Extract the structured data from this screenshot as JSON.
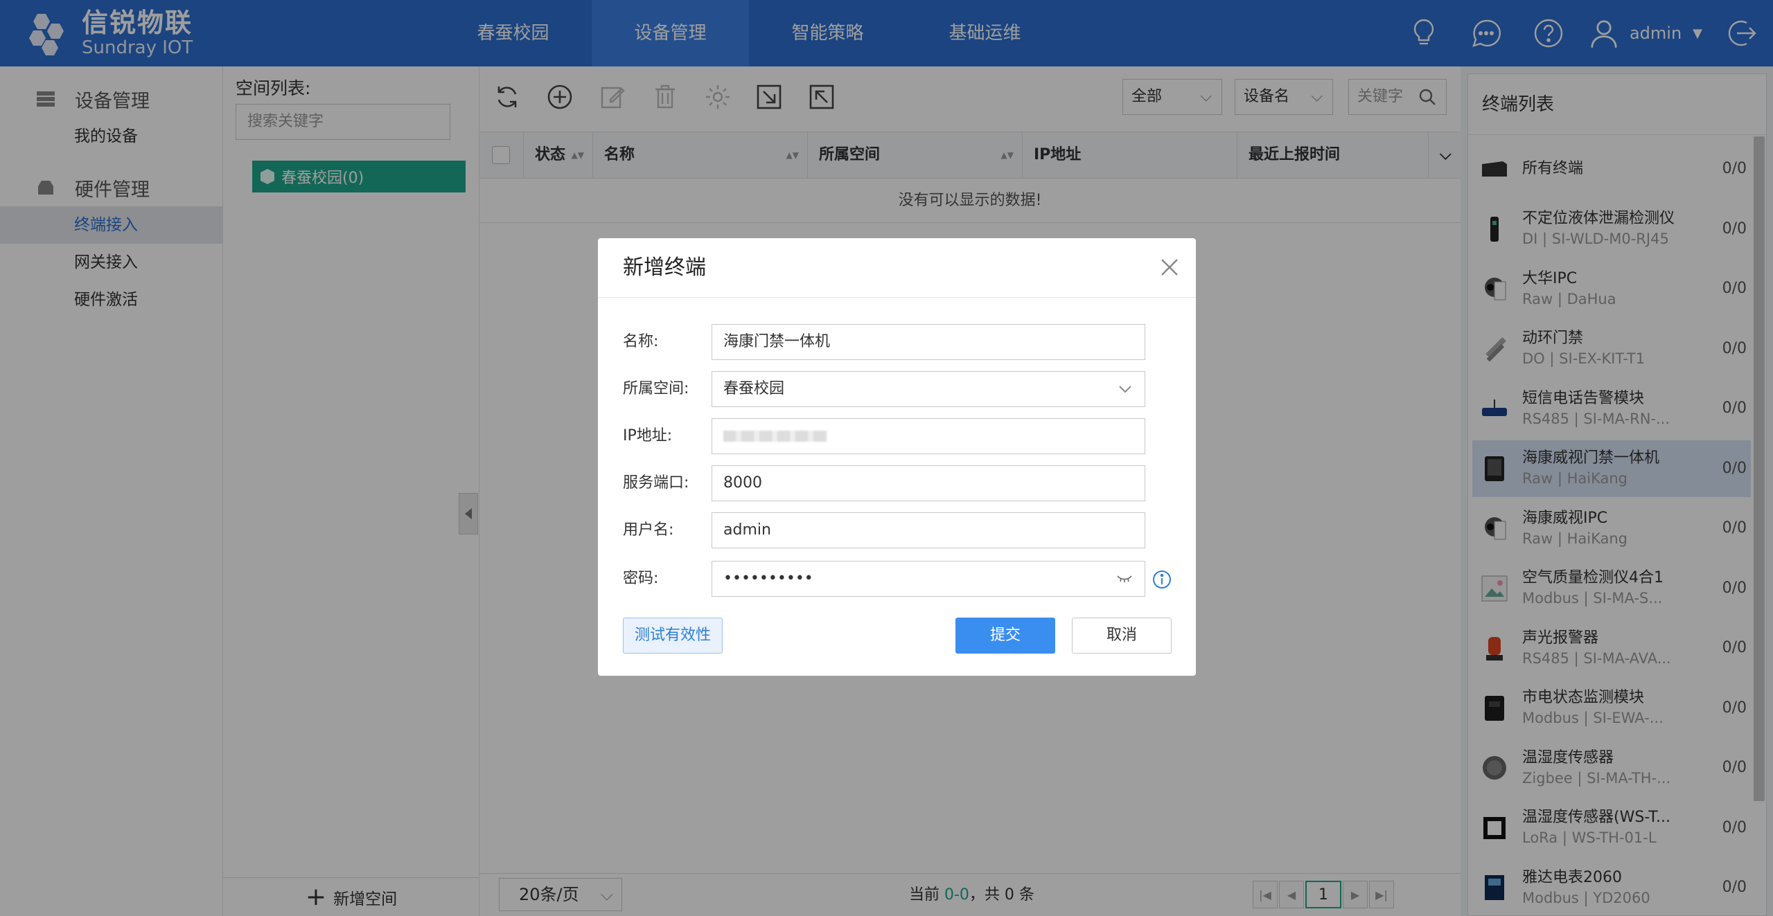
{
  "brand": {
    "name_cn": "信锐物联",
    "name_en": "Sundray IOT"
  },
  "nav": {
    "tabs": [
      {
        "label": "春蚕校园",
        "active": false
      },
      {
        "label": "设备管理",
        "active": true
      },
      {
        "label": "智能策略",
        "active": false
      },
      {
        "label": "基础运维",
        "active": false
      }
    ]
  },
  "header": {
    "user": "admin"
  },
  "sidebar": {
    "group1": "设备管理",
    "group1_items": [
      "我的设备"
    ],
    "group2": "硬件管理",
    "group2_items": [
      "终端接入",
      "网关接入",
      "硬件激活"
    ],
    "active_item": "终端接入"
  },
  "space": {
    "title": "空间列表:",
    "search_placeholder": "搜索关键字",
    "node": "春蚕校园(0)",
    "add_label": "新增空间"
  },
  "toolbar": {
    "filter_all": "全部",
    "filter_field": "设备名",
    "keyword_placeholder": "关键字"
  },
  "table": {
    "columns": [
      "状态",
      "名称",
      "所属空间",
      "IP地址",
      "最近上报时间"
    ],
    "empty": "没有可以显示的数据!"
  },
  "pager": {
    "page_size": "20条/页",
    "info_prefix": "当前 ",
    "info_range": "0-0",
    "info_suffix": "，共 0 条",
    "current_page": "1"
  },
  "terminal_list": {
    "title": "终端列表",
    "items": [
      {
        "name": "所有终端",
        "sub": "",
        "count": "0/0"
      },
      {
        "name": "不定位液体泄漏检测仪",
        "sub": "DI | SI-WLD-M0-RJ45",
        "count": "0/0"
      },
      {
        "name": "大华IPC",
        "sub": "Raw | DaHua",
        "count": "0/0"
      },
      {
        "name": "动环门禁",
        "sub": "DO | SI-EX-KIT-T1",
        "count": "0/0"
      },
      {
        "name": "短信电话告警模块",
        "sub": "RS485 | SI-MA-RN-...",
        "count": "0/0"
      },
      {
        "name": "海康威视门禁一体机",
        "sub": "Raw | HaiKang",
        "count": "0/0"
      },
      {
        "name": "海康威视IPC",
        "sub": "Raw | HaiKang",
        "count": "0/0"
      },
      {
        "name": "空气质量检测仪4合1",
        "sub": "Modbus | SI-MA-S...",
        "count": "0/0"
      },
      {
        "name": "声光报警器",
        "sub": "RS485 | SI-MA-AVA...",
        "count": "0/0"
      },
      {
        "name": "市电状态监测模块",
        "sub": "Modbus | SI-EWA-...",
        "count": "0/0"
      },
      {
        "name": "温湿度传感器",
        "sub": "Zigbee | SI-MA-TH-...",
        "count": "0/0"
      },
      {
        "name": "温湿度传感器(WS-T...",
        "sub": "LoRa | WS-TH-01-L",
        "count": "0/0"
      },
      {
        "name": "雅达电表2060",
        "sub": "Modbus | YD2060",
        "count": "0/0"
      }
    ],
    "active_index": 5
  },
  "modal": {
    "title": "新增终端",
    "fields": {
      "name_label": "名称:",
      "name_value": "海康门禁一体机",
      "space_label": "所属空间:",
      "space_value": "春蚕校园",
      "ip_label": "IP地址:",
      "port_label": "服务端口:",
      "port_value": "8000",
      "user_label": "用户名:",
      "user_value": "admin",
      "pwd_label": "密码:",
      "pwd_value": "••••••••••"
    },
    "test_button": "测试有效性",
    "submit_button": "提交",
    "cancel_button": "取消"
  },
  "colors": {
    "brand_blue": "#2d6fcf",
    "tree_green": "#1fa78c",
    "submit_blue": "#3a8ef0"
  }
}
